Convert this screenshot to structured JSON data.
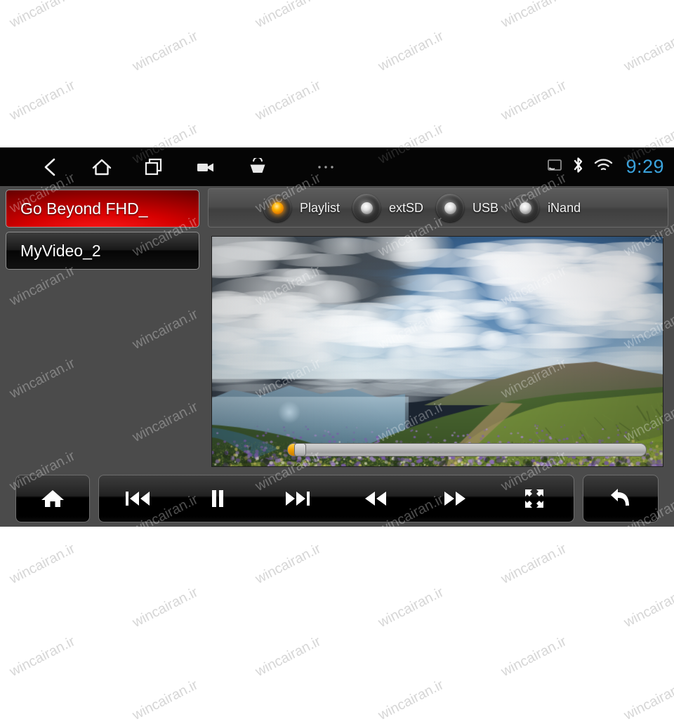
{
  "statusbar": {
    "nav_items": [
      {
        "name": "back-icon",
        "label": "Back"
      },
      {
        "name": "home-icon",
        "label": "Home"
      },
      {
        "name": "recents-icon",
        "label": "Recent apps"
      },
      {
        "name": "camera-icon",
        "label": "Camera"
      },
      {
        "name": "basket-icon",
        "label": "Apps"
      },
      {
        "name": "more-icon",
        "label": "More"
      }
    ],
    "cast_icon": "cast-icon",
    "bluetooth_icon": "bluetooth-icon",
    "wifi_icon": "wifi-icon",
    "clock": "9:29",
    "clock_color": "#3aa3dd"
  },
  "sidebar": {
    "items": [
      {
        "label": "Go Beyond FHD_",
        "selected": true
      },
      {
        "label": "MyVideo_2",
        "selected": false
      }
    ]
  },
  "player": {
    "sources": [
      {
        "label": "Playlist",
        "selected": true
      },
      {
        "label": "extSD",
        "selected": false
      },
      {
        "label": "USB",
        "selected": false
      },
      {
        "label": "iNand",
        "selected": false
      }
    ],
    "selected_led_color": "#ffb300",
    "seek": {
      "progress_percent": 2,
      "name": "video-seek-bar"
    },
    "video": {
      "description": "Mountain landscape with green alpine meadow, wildflowers and cloudy blue sky"
    }
  },
  "transport": {
    "home_label": "Home",
    "buttons": [
      {
        "name": "previous-track-button",
        "label": "Previous"
      },
      {
        "name": "pause-button",
        "label": "Pause"
      },
      {
        "name": "next-track-button",
        "label": "Next"
      },
      {
        "name": "rewind-button",
        "label": "Rewind"
      },
      {
        "name": "fast-forward-button",
        "label": "Fast forward"
      },
      {
        "name": "fullscreen-button",
        "label": "Fullscreen"
      }
    ],
    "back_label": "Back"
  },
  "watermark": {
    "text": "wincairan.ir"
  }
}
